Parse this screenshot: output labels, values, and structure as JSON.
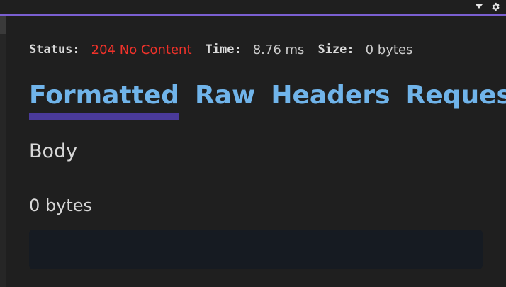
{
  "titlebar": {
    "icons": [
      "caret-down-icon",
      "gear-icon"
    ]
  },
  "status": {
    "status_label": "Status:",
    "status_value": "204 No Content",
    "time_label": "Time:",
    "time_value": "8.76 ms",
    "size_label": "Size:",
    "size_value": "0 bytes"
  },
  "tabs": [
    {
      "label": "Formatted",
      "active": true
    },
    {
      "label": "Raw",
      "active": false
    },
    {
      "label": "Headers",
      "active": false
    },
    {
      "label": "Request",
      "active": false
    }
  ],
  "body": {
    "title": "Body",
    "size_text": "0 bytes",
    "content": ""
  },
  "colors": {
    "accent": "#7a5fd0",
    "tab_text": "#70b4ea",
    "tab_underline": "#4a3a9a",
    "error": "#f0322a"
  }
}
